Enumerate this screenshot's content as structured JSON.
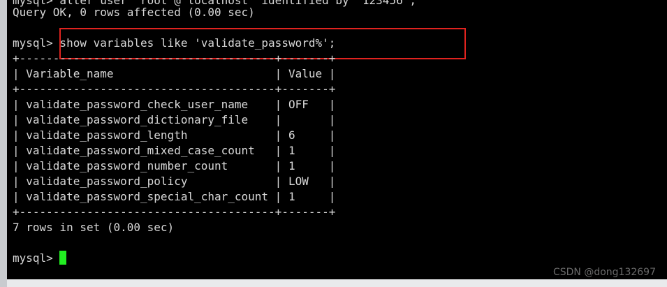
{
  "terminal": {
    "top_partial_line": "mysql> alter user 'root'@'localhost' identified by '123456';",
    "query_ok_line": "Query OK, 0 rows affected (0.00 sec)",
    "prompt": "mysql>",
    "command": " show variables like 'validate_password%';",
    "table": {
      "top_border": "+--------------------------------------+-------+",
      "header_row": "| Variable_name                        | Value |",
      "mid_border": "+--------------------------------------+-------+",
      "rows": [
        "| validate_password_check_user_name    | OFF   |",
        "| validate_password_dictionary_file    |       |",
        "| validate_password_length             | 6     |",
        "| validate_password_mixed_case_count   | 1     |",
        "| validate_password_number_count       | 1     |",
        "| validate_password_policy             | LOW   |",
        "| validate_password_special_char_count | 1     |"
      ],
      "bottom_border": "+--------------------------------------+-------+"
    },
    "result_line": "7 rows in set (0.00 sec)",
    "final_prompt": "mysql> "
  },
  "watermark": "CSDN @dong132697",
  "colors": {
    "background": "#000000",
    "text": "#d8d8d8",
    "highlight_border": "#e0231f",
    "cursor": "#22ee22"
  }
}
